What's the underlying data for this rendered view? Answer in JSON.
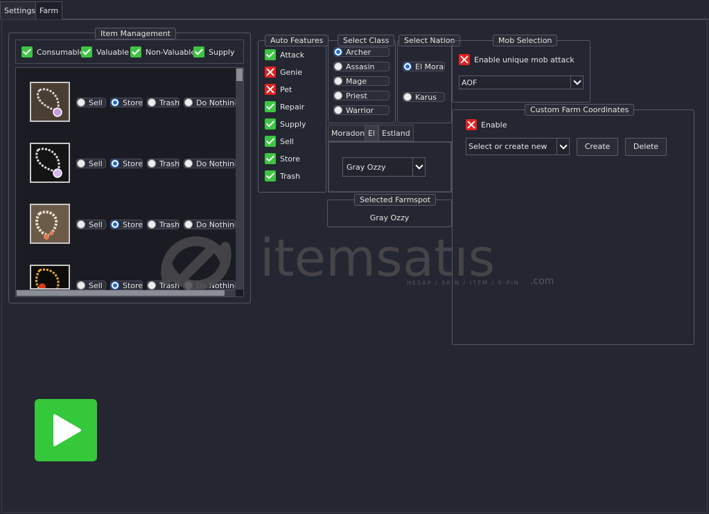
{
  "tabs": [
    {
      "label": "Settings"
    },
    {
      "label": "Farm"
    }
  ],
  "item_management": {
    "title": "Item Management",
    "filters": [
      {
        "label": "Consumable",
        "checked": true
      },
      {
        "label": "Valuable",
        "checked": true
      },
      {
        "label": "Non-Valuable",
        "checked": true
      },
      {
        "label": "Supply",
        "checked": true
      }
    ],
    "action_labels": [
      "Sell",
      "Store",
      "Trash",
      "Do Nothing"
    ],
    "items": [
      {
        "icon": "silver-necklace-purple-gem-icon",
        "selected": "Store"
      },
      {
        "icon": "silver-necklace-violet-gem-icon",
        "selected": "Store"
      },
      {
        "icon": "pearl-necklace-orange-icon",
        "selected": "Store"
      },
      {
        "icon": "gold-necklace-red-gem-icon",
        "selected": "Store"
      }
    ]
  },
  "auto_features": {
    "title": "Auto Features",
    "items": [
      {
        "label": "Attack",
        "checked": true
      },
      {
        "label": "Genie",
        "checked": false
      },
      {
        "label": "Pet",
        "checked": false
      },
      {
        "label": "Repair",
        "checked": true
      },
      {
        "label": "Supply",
        "checked": true
      },
      {
        "label": "Sell",
        "checked": true
      },
      {
        "label": "Store",
        "checked": true
      },
      {
        "label": "Trash",
        "checked": true
      }
    ]
  },
  "select_class": {
    "title": "Select Class",
    "options": [
      {
        "label": "Archer",
        "selected": true
      },
      {
        "label": "Assasin",
        "selected": false
      },
      {
        "label": "Mage",
        "selected": false
      },
      {
        "label": "Priest",
        "selected": false
      },
      {
        "label": "Warrior",
        "selected": false
      }
    ]
  },
  "select_nation": {
    "title": "Select Nation",
    "options": [
      {
        "label": "El Morad",
        "selected": true
      },
      {
        "label": "Karus",
        "selected": false
      }
    ]
  },
  "zone_tabs": [
    {
      "label": "Moradon"
    },
    {
      "label": "El"
    },
    {
      "label": "Estland"
    }
  ],
  "farmspot_select": {
    "value": "Gray Ozzy"
  },
  "selected_farmspot": {
    "title": "Selected Farmspot",
    "value": "Gray Ozzy"
  },
  "mob_selection": {
    "title": "Mob Selection",
    "unique_mob_label": "Enable unique mob attack",
    "unique_mob_checked": false,
    "mob_value": "AOF"
  },
  "custom_farm": {
    "title": "Custom Farm Coordinates",
    "enable_label": "Enable",
    "enable_checked": false,
    "select_value": "Select or create new pa",
    "create_label": "Create",
    "delete_label": "Delete"
  },
  "watermark": {
    "brand": "itemsatis",
    "tagline": "HESAP / SKIN / ITEM / E-PIN",
    "suffix": ".com"
  },
  "colors": {
    "background": "#242631",
    "check_on": "#3ec444",
    "check_off": "#e52020",
    "radio_selected": "#1c6bd6",
    "start_button": "#35c83a"
  },
  "start_button": {
    "icon": "play-icon"
  }
}
